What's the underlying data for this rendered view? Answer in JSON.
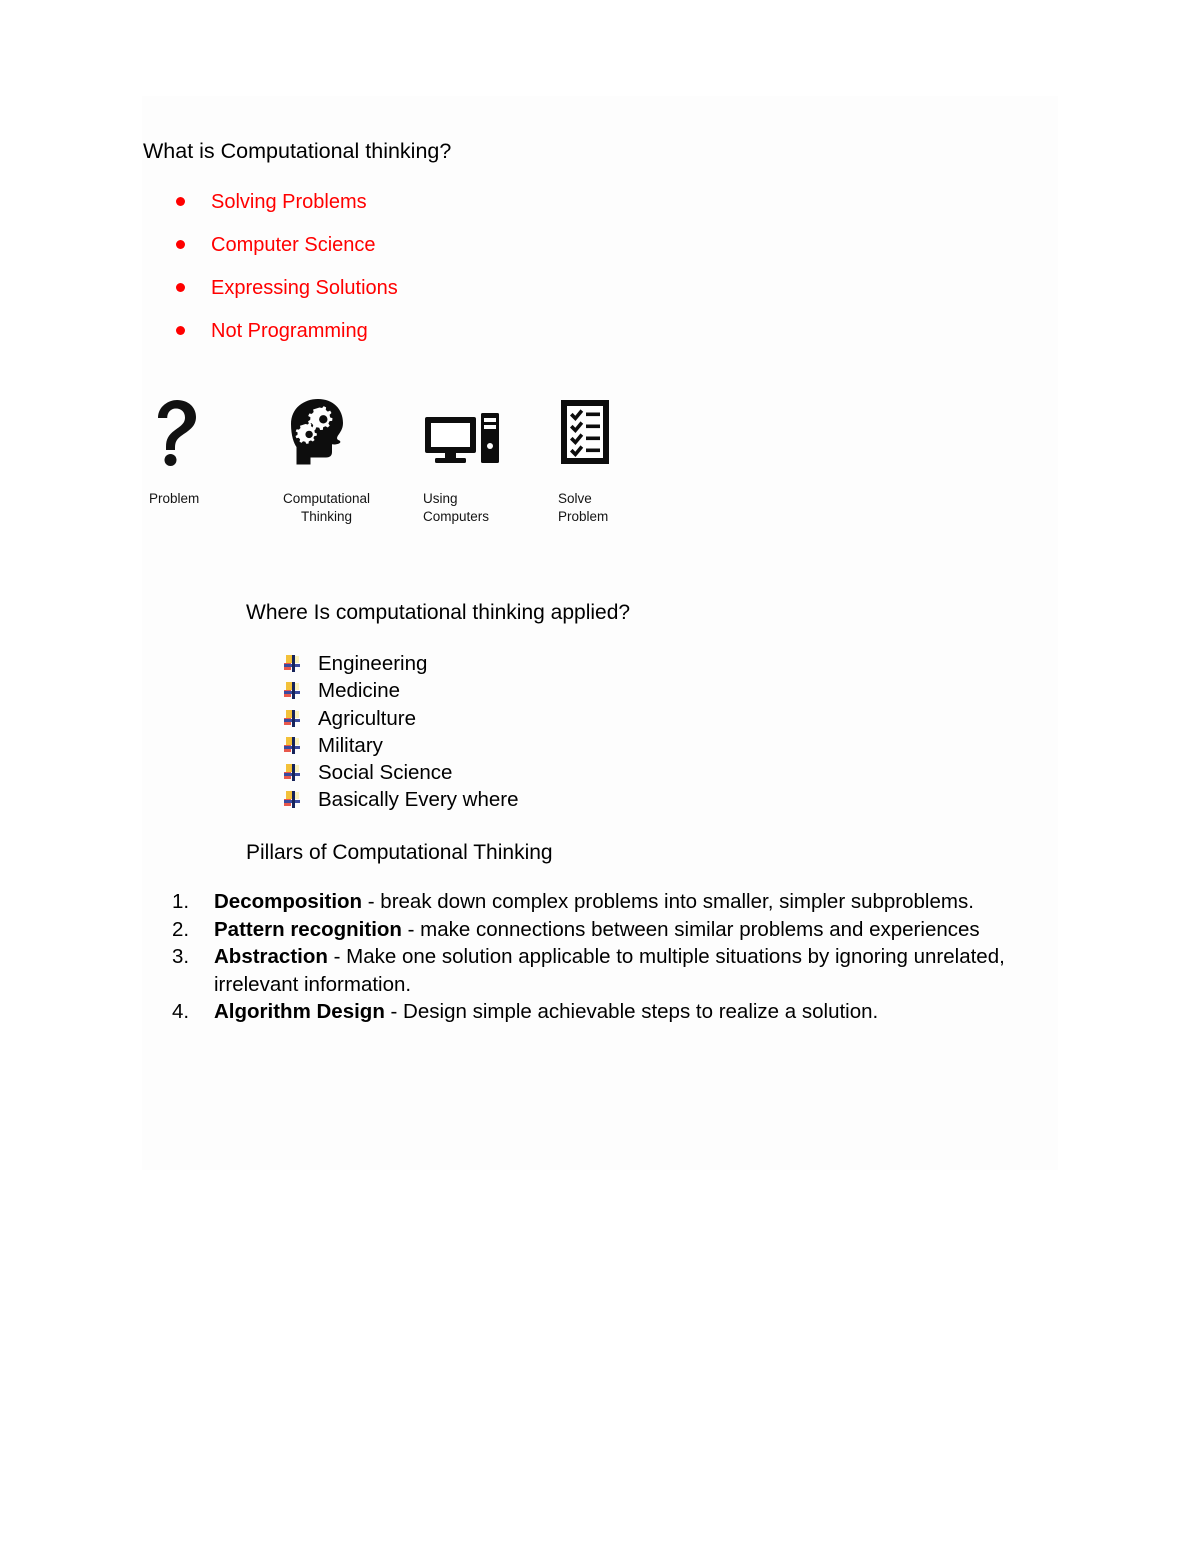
{
  "document": {
    "title": "What is Computational thinking?"
  },
  "intro_bullets": [
    {
      "label": "Solving Problems"
    },
    {
      "label": "Computer Science"
    },
    {
      "label": "Expressing Solutions"
    },
    {
      "label": "Not Programming"
    }
  ],
  "intro_bullet_color": "#FF0000",
  "process_icons": [
    {
      "icon": "question-mark-icon",
      "caption": "Problem"
    },
    {
      "icon": "head-with-gears-icon",
      "caption": "Computational\nThinking"
    },
    {
      "icon": "desktop-computer-icon",
      "caption": "Using\nComputers"
    },
    {
      "icon": "checklist-clipboard-icon",
      "caption": "Solve\nProblem"
    }
  ],
  "applied": {
    "heading": "Where Is computational thinking applied?",
    "items": [
      "Engineering",
      "Medicine",
      "Agriculture",
      "Military",
      "Social Science",
      "Basically Every where"
    ]
  },
  "pillars": {
    "heading": "Pillars of Computational Thinking",
    "items": [
      {
        "number": "1.",
        "term": "Decomposition",
        "description": " -  break down complex problems into smaller, simpler subproblems."
      },
      {
        "number": "2.",
        "term": "Pattern recognition",
        "description": " - make connections between similar problems and experiences"
      },
      {
        "number": "3.",
        "term": "Abstraction",
        "description": " - Make one solution applicable to multiple situations by ignoring unrelated, irrelevant information."
      },
      {
        "number": "4.",
        "term": "Algorithm Design",
        "description": " - Design simple achievable steps to realize a solution."
      }
    ]
  }
}
